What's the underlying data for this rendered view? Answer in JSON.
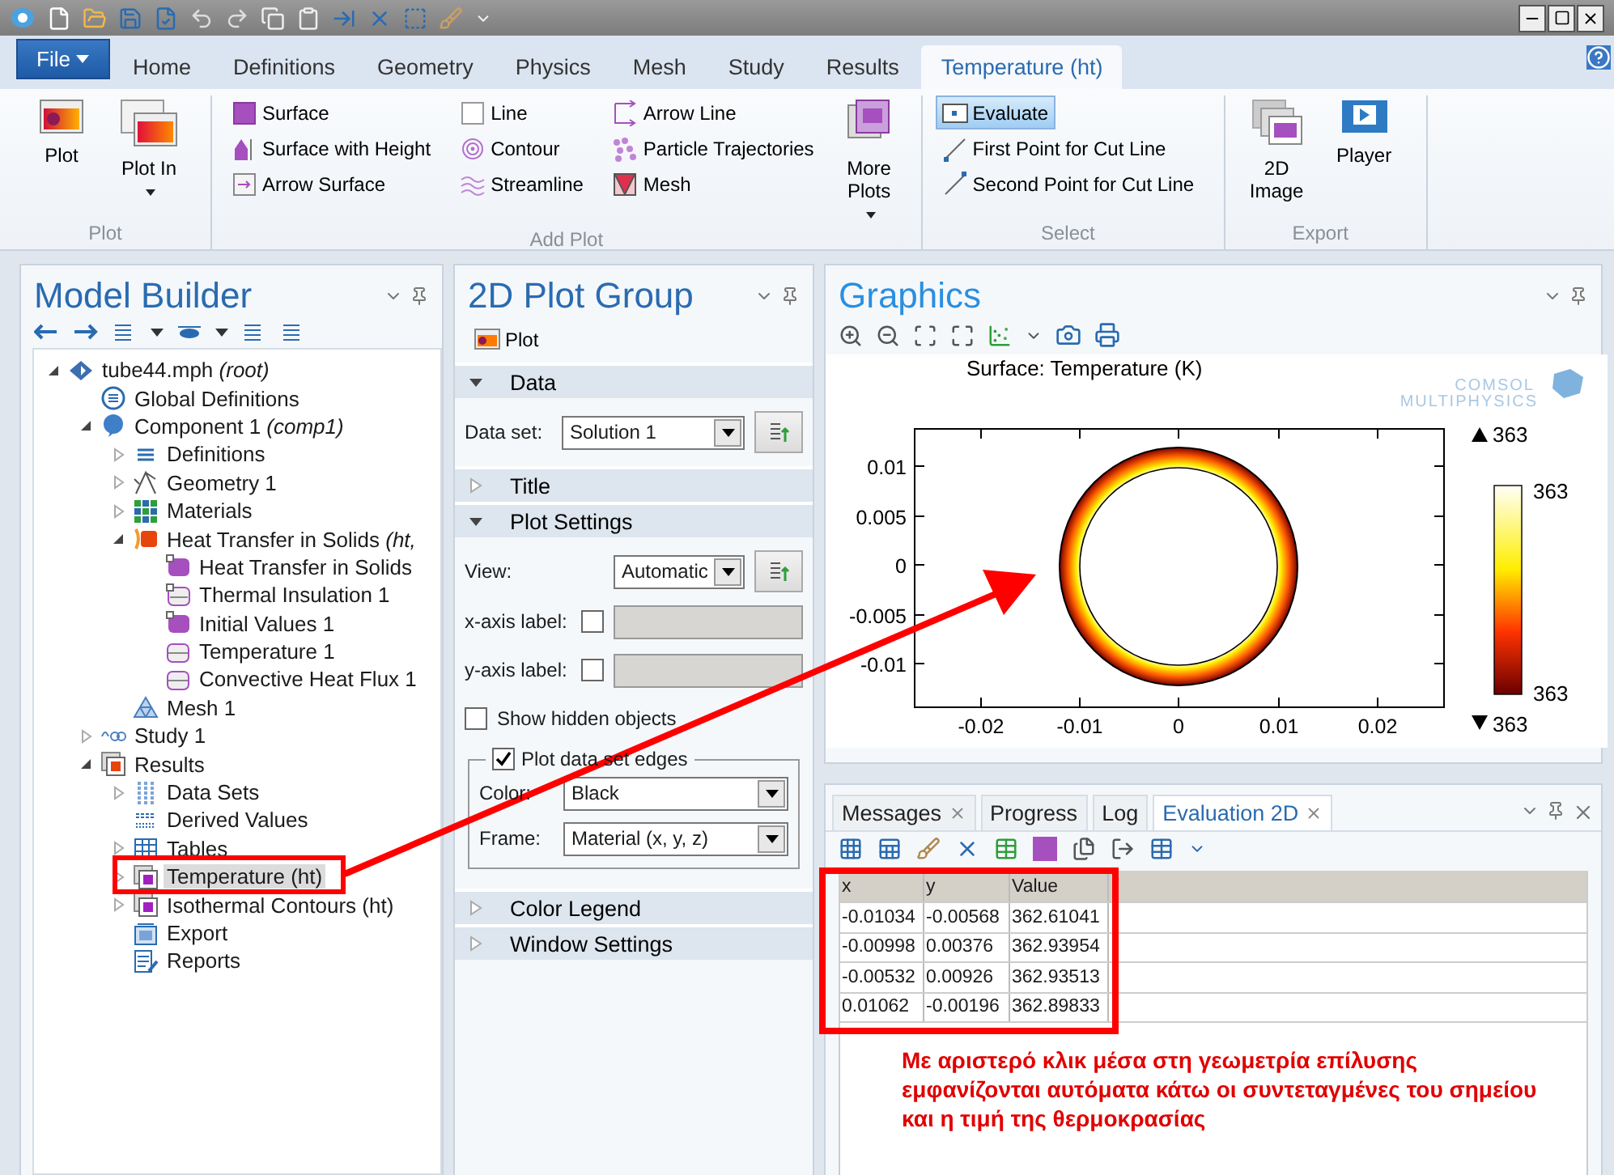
{
  "tabs": [
    {
      "label": "File",
      "kind": "file",
      "selected": false
    },
    {
      "label": "Home",
      "kind": "tab",
      "selected": false
    },
    {
      "label": "Definitions",
      "kind": "tab",
      "selected": false
    },
    {
      "label": "Geometry",
      "kind": "tab",
      "selected": false
    },
    {
      "label": "Physics",
      "kind": "tab",
      "selected": false
    },
    {
      "label": "Mesh",
      "kind": "tab",
      "selected": false
    },
    {
      "label": "Study",
      "kind": "tab",
      "selected": false
    },
    {
      "label": "Results",
      "kind": "tab",
      "selected": false
    },
    {
      "label": "Temperature (ht)",
      "kind": "tab",
      "selected": true
    }
  ],
  "ribbon": [
    {
      "label": "Plot",
      "items": [
        {
          "kind": "plot",
          "label": "Plot"
        },
        {
          "kind": "plot-in",
          "label": "Plot In",
          "dropdown": true
        }
      ]
    },
    {
      "label": "Add Plot",
      "items": [
        {
          "kind": "surface",
          "label": "Surface"
        },
        {
          "kind": "surface-height",
          "label": "Surface with Height"
        },
        {
          "kind": "arrow-surface",
          "label": "Arrow Surface"
        },
        {
          "kind": "line",
          "label": "Line"
        },
        {
          "kind": "contour",
          "label": "Contour"
        },
        {
          "kind": "streamline",
          "label": "Streamline"
        },
        {
          "kind": "arrow-line",
          "label": "Arrow Line"
        },
        {
          "kind": "particles",
          "label": "Particle Trajectories"
        },
        {
          "kind": "mesh",
          "label": "Mesh"
        },
        {
          "kind": "more-plots",
          "label": "More Plots",
          "dropdown": true
        }
      ]
    },
    {
      "label": "Select",
      "items": [
        {
          "kind": "evaluate",
          "label": "Evaluate",
          "selected": true
        },
        {
          "kind": "first-point",
          "label": "First Point for Cut Line",
          "selected": false
        },
        {
          "kind": "second-point",
          "label": "Second Point for Cut Line",
          "selected": false
        }
      ]
    },
    {
      "label": "Export",
      "items": [
        {
          "kind": "image",
          "label": "2D Image"
        },
        {
          "kind": "player",
          "label": "Player"
        }
      ]
    }
  ],
  "model_builder": {
    "title": "Model Builder",
    "tree": [
      {
        "label": "tube44.mph *(root)*",
        "kind": "file",
        "expanded": true,
        "selected": false,
        "children": [
          {
            "label": "Global Definitions",
            "kind": "global",
            "selected": false
          },
          {
            "label": "Component 1 *(comp1)*",
            "kind": "component",
            "expanded": true,
            "selected": false,
            "children": [
              {
                "label": "Definitions",
                "kind": "definitions",
                "expanded": false,
                "selected": false
              },
              {
                "label": "Geometry 1",
                "kind": "geometry",
                "expanded": false,
                "selected": false
              },
              {
                "label": "Materials",
                "kind": "materials",
                "expanded": false,
                "selected": false
              },
              {
                "label": "Heat Transfer in Solids *(ht,*",
                "kind": "physics",
                "expanded": true,
                "selected": false,
                "children": [
                  {
                    "label": "Heat Transfer in Solids",
                    "kind": "domain",
                    "selected": false
                  },
                  {
                    "label": "Thermal Insulation 1",
                    "kind": "boundary-default",
                    "selected": false
                  },
                  {
                    "label": "Initial Values 1",
                    "kind": "domain",
                    "selected": false
                  },
                  {
                    "label": "Temperature 1",
                    "kind": "boundary",
                    "selected": false
                  },
                  {
                    "label": "Convective Heat Flux 1",
                    "kind": "boundary",
                    "selected": false
                  }
                ]
              },
              {
                "label": "Mesh 1",
                "kind": "mesh",
                "selected": false
              }
            ]
          },
          {
            "label": "Study 1",
            "kind": "study",
            "expanded": false,
            "selected": false
          },
          {
            "label": "Results",
            "kind": "results",
            "expanded": true,
            "selected": false,
            "children": [
              {
                "label": "Data Sets",
                "kind": "datasets",
                "expanded": false,
                "selected": false
              },
              {
                "label": "Derived Values",
                "kind": "derived",
                "selected": false
              },
              {
                "label": "Tables",
                "kind": "tables",
                "expanded": false,
                "selected": false
              },
              {
                "label": "Temperature (ht)",
                "kind": "plotgroup",
                "expanded": false,
                "selected": true
              },
              {
                "label": "Isothermal Contours (ht)",
                "kind": "plotgroup",
                "expanded": false,
                "selected": false
              },
              {
                "label": "Export",
                "kind": "export",
                "selected": false
              },
              {
                "label": "Reports",
                "kind": "reports",
                "selected": false
              }
            ]
          }
        ]
      }
    ]
  },
  "settings": {
    "title": "2D Plot Group",
    "plot_button": "Plot",
    "sections": [
      {
        "label": "Data",
        "expanded": true,
        "fields": [
          {
            "kind": "select",
            "label": "Data set:",
            "value": "Solution 1"
          }
        ]
      },
      {
        "label": "Title",
        "expanded": false
      },
      {
        "label": "Plot Settings",
        "expanded": true,
        "fields": [
          {
            "kind": "select",
            "label": "View:",
            "value": "Automatic"
          },
          {
            "kind": "axis",
            "label": "x-axis label:",
            "checked": false
          },
          {
            "kind": "axis",
            "label": "y-axis label:",
            "checked": false
          },
          {
            "kind": "checkbox",
            "label": "Show hidden objects",
            "checked": false
          },
          {
            "kind": "group",
            "label": "Plot data set edges",
            "checked": true,
            "fields": [
              {
                "kind": "select",
                "label": "Color:",
                "value": "Black"
              },
              {
                "kind": "select",
                "label": "Frame:",
                "value": "Material  (x, y, z)"
              }
            ]
          }
        ]
      },
      {
        "label": "Color Legend",
        "expanded": false
      },
      {
        "label": "Window Settings",
        "expanded": false
      }
    ]
  },
  "graphics": {
    "title": "Graphics",
    "plot_title": "Surface: Temperature (K)",
    "logo": [
      "COMSOL",
      "MULTIPHYSICS"
    ],
    "yticks": [
      "0.01",
      "0.005",
      "0",
      "-0.005",
      "-0.01"
    ],
    "xticks": [
      "-0.02",
      "-0.01",
      "0",
      "0.01",
      "0.02"
    ],
    "range_max": "363",
    "range_min": "363",
    "legend_max": "363",
    "legend_min": "363"
  },
  "output": {
    "tabs": [
      {
        "label": "Messages",
        "closable": true,
        "selected": false
      },
      {
        "label": "Progress",
        "closable": false,
        "selected": false
      },
      {
        "label": "Log",
        "closable": false,
        "selected": false
      },
      {
        "label": "Evaluation 2D",
        "closable": true,
        "selected": true
      }
    ],
    "table": {
      "columns": [
        "x",
        "y",
        "Value"
      ],
      "rows": [
        [
          "-0.01034",
          "-0.00568",
          "362.61041"
        ],
        [
          "-0.00998",
          "0.00376",
          "362.93954"
        ],
        [
          "-0.00532",
          "0.00926",
          "362.93513"
        ],
        [
          "0.01062",
          "-0.00196",
          "362.89833"
        ]
      ]
    },
    "note": "Με αριστερό κλικ μέσα στη γεωμετρία επίλυσης εμφανίζονται αυτόματα κάτω οι συντεταγμένες του σημείου και η τιμή της θερμοκρασίας"
  }
}
